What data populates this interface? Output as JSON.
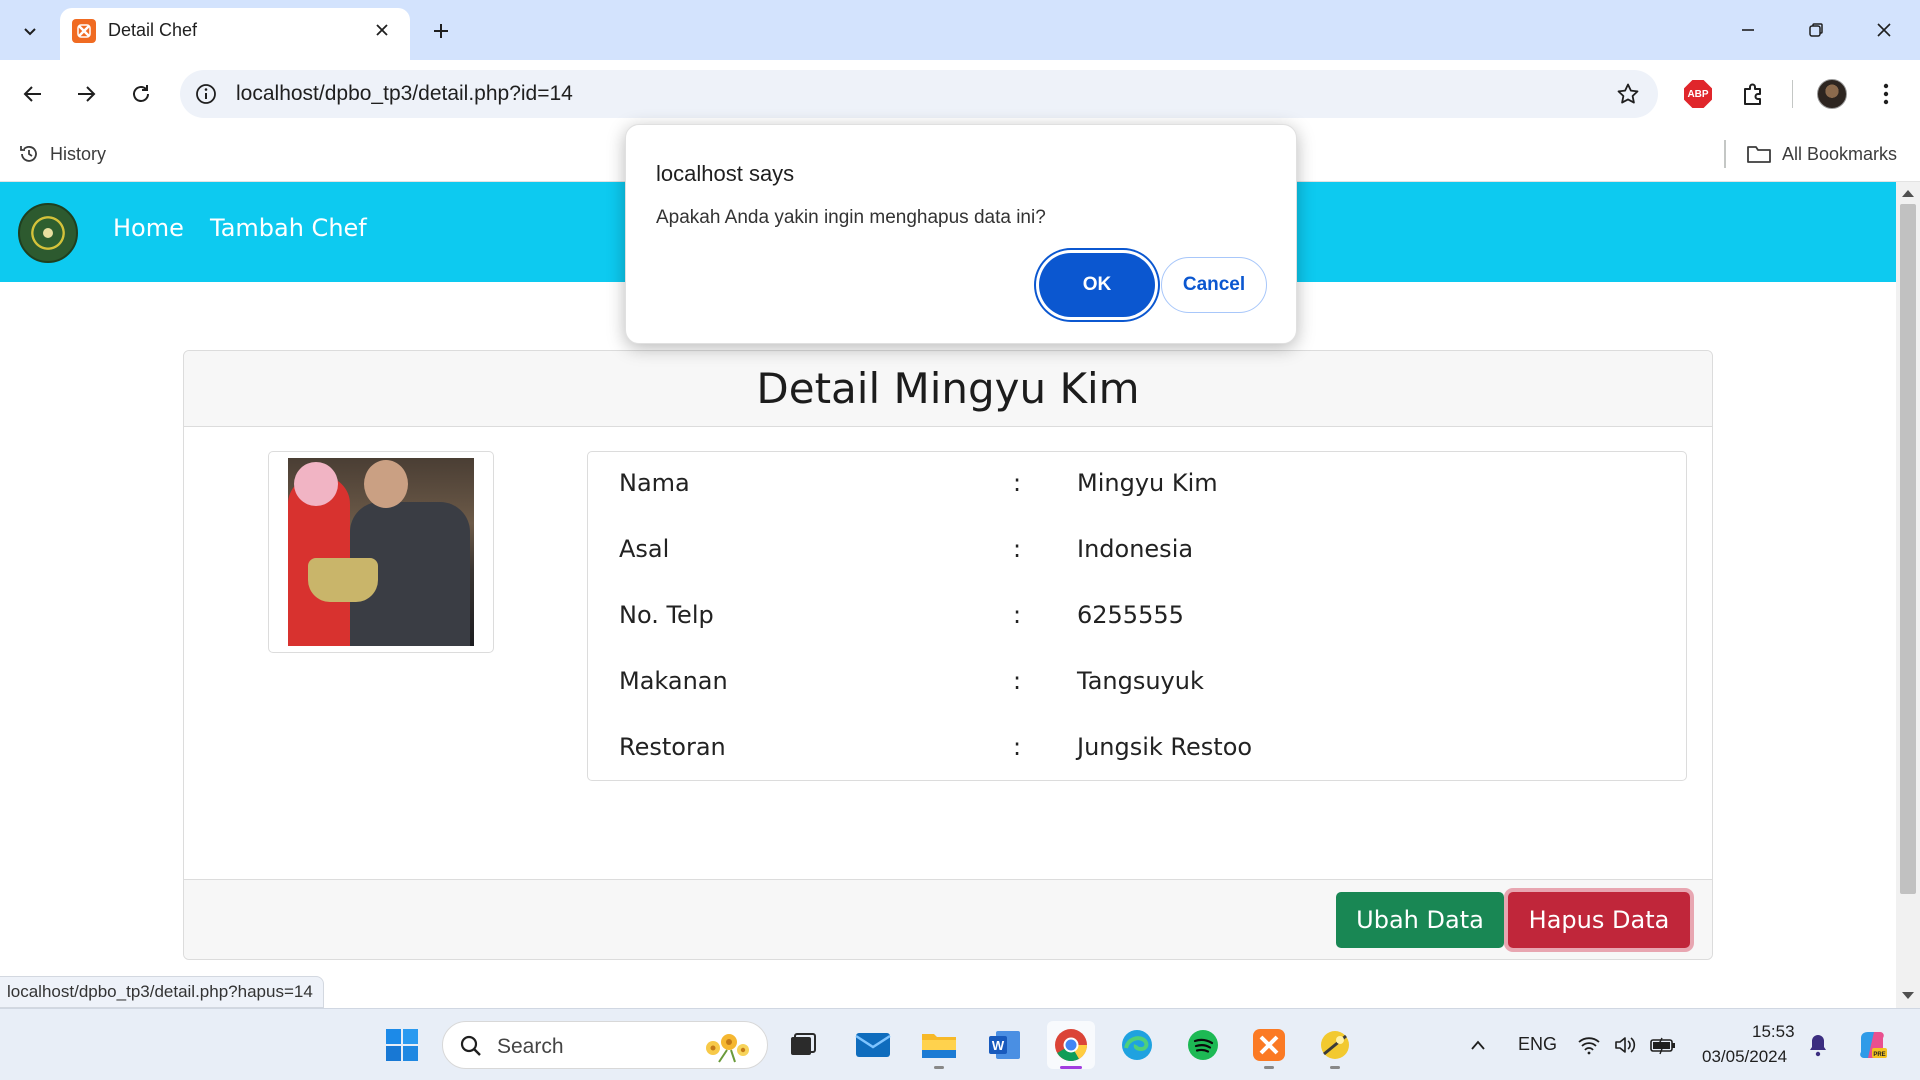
{
  "browser": {
    "tab_title": "Detail Chef",
    "url": "localhost/dpbo_tp3/detail.php?id=14",
    "bookmarks": {
      "history": "History",
      "all_bookmarks": "All Bookmarks"
    },
    "status_url": "localhost/dpbo_tp3/detail.php?hapus=14"
  },
  "navbar": {
    "home": "Home",
    "add_chef": "Tambah Chef"
  },
  "detail": {
    "title": "Detail Mingyu Kim",
    "rows": [
      {
        "label": "Nama",
        "colon": ":",
        "value": "Mingyu Kim"
      },
      {
        "label": "Asal",
        "colon": ":",
        "value": "Indonesia"
      },
      {
        "label": "No. Telp",
        "colon": ":",
        "value": "6255555"
      },
      {
        "label": "Makanan",
        "colon": ":",
        "value": "Tangsuyuk"
      },
      {
        "label": "Restoran",
        "colon": ":",
        "value": "Jungsik Restoo"
      }
    ],
    "edit_button": "Ubah Data",
    "delete_button": "Hapus Data"
  },
  "dialog": {
    "title": "localhost says",
    "message": "Apakah Anda yakin ingin menghapus data ini?",
    "ok": "OK",
    "cancel": "Cancel"
  },
  "taskbar": {
    "search_placeholder": "Search",
    "language": "ENG",
    "time": "15:53",
    "date": "03/05/2024"
  },
  "colors": {
    "navbar": "#0dcaf0",
    "edit_button": "#198754",
    "delete_button": "#c0263a",
    "dialog_primary": "#0b57d0"
  }
}
